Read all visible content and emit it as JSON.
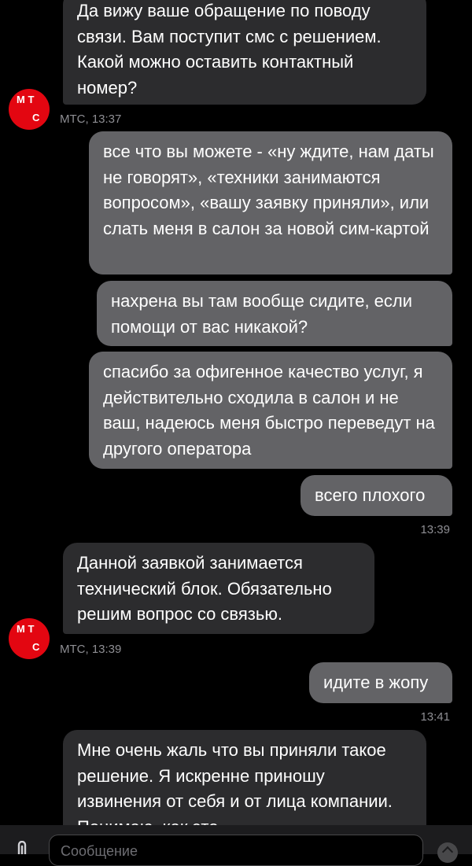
{
  "avatar": {
    "line1": "М Т",
    "line2": "С"
  },
  "messages": [
    {
      "text": "Да вижу ваше обращение по поводу связи. Вам поступит смс с решением. Какой можно оставить контактный номер?"
    },
    {
      "meta": "МТС, 13:37"
    },
    {
      "text": "все что вы можете - «ну ждите, нам даты не говорят», «техники занимаются вопросом», «вашу заявку приняли», или слать меня в салон за новой сим-картой"
    },
    {
      "text": "нахрена вы там вообще сидите, если помощи от вас никакой?"
    },
    {
      "text": "спасибо за офигенное качество услуг, я действительно сходила в салон и не ваш, надеюсь меня быстро переведут на другого оператора"
    },
    {
      "text": "всего плохого"
    },
    {
      "time": "13:39"
    },
    {
      "text": "Данной заявкой занимается технический блок. Обязательно решим вопрос со связью."
    },
    {
      "meta": "МТС, 13:39"
    },
    {
      "text": "идите в жопу"
    },
    {
      "time": "13:41"
    },
    {
      "text": "Мне очень жаль что вы приняли такое решение. Я искренне приношу извинения от себя и от лица компании. Понимаю, как это"
    }
  ],
  "composer": {
    "placeholder": "Сообщение"
  },
  "colors": {
    "incoming": "#2c2c2e",
    "outgoing": "#636366",
    "brand": "#e30611",
    "background": "#000000"
  },
  "icons": {
    "attach": "paperclip-icon",
    "send": "send-arrow-icon"
  }
}
